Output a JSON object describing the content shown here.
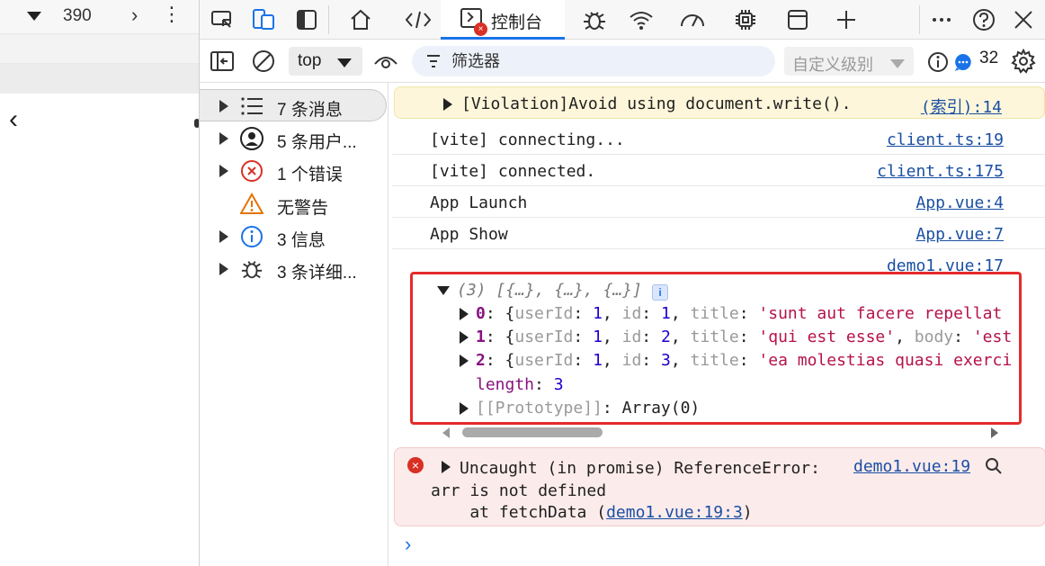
{
  "device": {
    "width_value": "390"
  },
  "tabs": {
    "console_label": "控制台",
    "console_badge": "×"
  },
  "toolbar": {
    "context": "top",
    "filter_placeholder": "筛选器",
    "levels_label": "自定义级别",
    "issues_count": "32"
  },
  "sidebar": {
    "items": [
      {
        "label": "7 条消息"
      },
      {
        "label": "5 条用户..."
      },
      {
        "label": "1 个错误"
      },
      {
        "label": "无警告"
      },
      {
        "label": "3 信息"
      },
      {
        "label": "3 条详细..."
      }
    ]
  },
  "console": {
    "violation": {
      "text": "[Violation]Avoid using document.write().",
      "source": "(索引):14"
    },
    "messages": [
      {
        "text": "[vite] connecting...",
        "source": "client.ts:19"
      },
      {
        "text": "[vite] connected.",
        "source": "client.ts:175"
      },
      {
        "text": "App Launch",
        "source": "App.vue:4"
      },
      {
        "text": "App Show",
        "source": "App.vue:7"
      }
    ],
    "log_source": "demo1.vue:17",
    "array": {
      "summary_count": "(3)",
      "summary_preview": "[{…}, {…}, {…}]",
      "info_badge": "i",
      "items": [
        {
          "index": "0",
          "userId": "1",
          "id": "1",
          "title": "'sunt aut facere repellat",
          "rest": ""
        },
        {
          "index": "1",
          "userId": "1",
          "id": "2",
          "title": "'qui est esse'",
          "rest": ", body: 'est"
        },
        {
          "index": "2",
          "userId": "1",
          "id": "3",
          "title": "'ea molestias quasi exerci",
          "rest": ""
        }
      ],
      "length_key": "length",
      "length_value": "3",
      "prototype_key": "[[Prototype]]",
      "prototype_value": "Array(0)"
    },
    "error": {
      "line1": "Uncaught (in promise) ReferenceError:",
      "line2": "arr is not defined",
      "line3_prefix": "    at fetchData (",
      "line3_link": "demo1.vue:19:3",
      "line3_suffix": ")",
      "source": "demo1.vue:19",
      "icon": "×"
    },
    "prompt": "›"
  }
}
